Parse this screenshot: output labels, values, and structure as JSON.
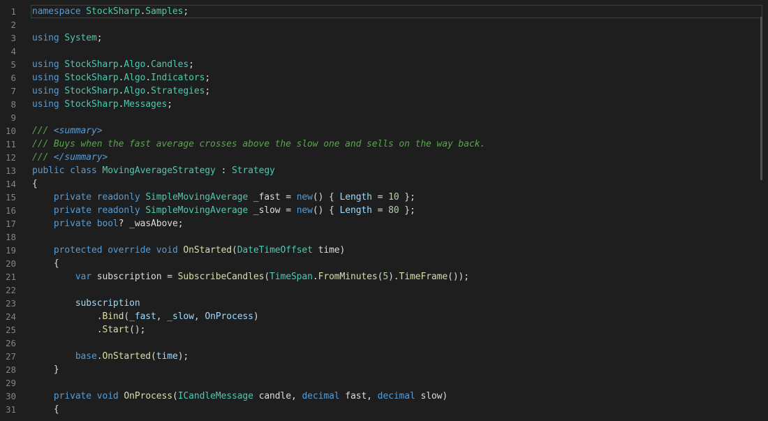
{
  "editor": {
    "line_numbers": [
      "1",
      "2",
      "3",
      "4",
      "5",
      "6",
      "7",
      "8",
      "9",
      "10",
      "11",
      "12",
      "13",
      "14",
      "15",
      "16",
      "17",
      "18",
      "19",
      "20",
      "21",
      "22",
      "23",
      "24",
      "25",
      "26",
      "27",
      "28",
      "29",
      "30",
      "31"
    ],
    "lines": [
      [
        [
          "kw",
          "namespace"
        ],
        [
          "id",
          " "
        ],
        [
          "ns",
          "StockSharp"
        ],
        [
          "punc",
          "."
        ],
        [
          "ns",
          "Samples"
        ],
        [
          "punc",
          ";"
        ]
      ],
      [],
      [
        [
          "kw",
          "using"
        ],
        [
          "id",
          " "
        ],
        [
          "ns",
          "System"
        ],
        [
          "punc",
          ";"
        ]
      ],
      [],
      [
        [
          "kw",
          "using"
        ],
        [
          "id",
          " "
        ],
        [
          "ns",
          "StockSharp"
        ],
        [
          "punc",
          "."
        ],
        [
          "ns",
          "Algo"
        ],
        [
          "punc",
          "."
        ],
        [
          "ns",
          "Candles"
        ],
        [
          "punc",
          ";"
        ]
      ],
      [
        [
          "kw",
          "using"
        ],
        [
          "id",
          " "
        ],
        [
          "ns",
          "StockSharp"
        ],
        [
          "punc",
          "."
        ],
        [
          "ns",
          "Algo"
        ],
        [
          "punc",
          "."
        ],
        [
          "ns",
          "Indicators"
        ],
        [
          "punc",
          ";"
        ]
      ],
      [
        [
          "kw",
          "using"
        ],
        [
          "id",
          " "
        ],
        [
          "ns",
          "StockSharp"
        ],
        [
          "punc",
          "."
        ],
        [
          "ns",
          "Algo"
        ],
        [
          "punc",
          "."
        ],
        [
          "ns",
          "Strategies"
        ],
        [
          "punc",
          ";"
        ]
      ],
      [
        [
          "kw",
          "using"
        ],
        [
          "id",
          " "
        ],
        [
          "ns",
          "StockSharp"
        ],
        [
          "punc",
          "."
        ],
        [
          "ns",
          "Messages"
        ],
        [
          "punc",
          ";"
        ]
      ],
      [],
      [
        [
          "comment",
          "/// "
        ],
        [
          "xml",
          "<summary>"
        ]
      ],
      [
        [
          "comment",
          "/// Buys when the fast average crosses above the slow one and sells on the way back."
        ]
      ],
      [
        [
          "comment",
          "/// "
        ],
        [
          "xml",
          "</summary>"
        ]
      ],
      [
        [
          "kw",
          "public"
        ],
        [
          "id",
          " "
        ],
        [
          "kw",
          "class"
        ],
        [
          "id",
          " "
        ],
        [
          "type",
          "MovingAverageStrategy"
        ],
        [
          "id",
          " "
        ],
        [
          "punc",
          ":"
        ],
        [
          "id",
          " "
        ],
        [
          "type",
          "Strategy"
        ]
      ],
      [
        [
          "punc",
          "{"
        ]
      ],
      [
        [
          "id",
          "    "
        ],
        [
          "kw",
          "private"
        ],
        [
          "id",
          " "
        ],
        [
          "kw",
          "readonly"
        ],
        [
          "id",
          " "
        ],
        [
          "type",
          "SimpleMovingAverage"
        ],
        [
          "id",
          " _fast "
        ],
        [
          "punc",
          "="
        ],
        [
          "id",
          " "
        ],
        [
          "kw",
          "new"
        ],
        [
          "punc",
          "() { "
        ],
        [
          "prop",
          "Length"
        ],
        [
          "id",
          " "
        ],
        [
          "punc",
          "="
        ],
        [
          "id",
          " "
        ],
        [
          "num",
          "10"
        ],
        [
          "punc",
          " };"
        ]
      ],
      [
        [
          "id",
          "    "
        ],
        [
          "kw",
          "private"
        ],
        [
          "id",
          " "
        ],
        [
          "kw",
          "readonly"
        ],
        [
          "id",
          " "
        ],
        [
          "type",
          "SimpleMovingAverage"
        ],
        [
          "id",
          " _slow "
        ],
        [
          "punc",
          "="
        ],
        [
          "id",
          " "
        ],
        [
          "kw",
          "new"
        ],
        [
          "punc",
          "() { "
        ],
        [
          "prop",
          "Length"
        ],
        [
          "id",
          " "
        ],
        [
          "punc",
          "="
        ],
        [
          "id",
          " "
        ],
        [
          "num",
          "80"
        ],
        [
          "punc",
          " };"
        ]
      ],
      [
        [
          "id",
          "    "
        ],
        [
          "kw",
          "private"
        ],
        [
          "id",
          " "
        ],
        [
          "kw",
          "bool"
        ],
        [
          "punc",
          "?"
        ],
        [
          "id",
          " _wasAbove"
        ],
        [
          "punc",
          ";"
        ]
      ],
      [],
      [
        [
          "id",
          "    "
        ],
        [
          "kw",
          "protected"
        ],
        [
          "id",
          " "
        ],
        [
          "kw",
          "override"
        ],
        [
          "id",
          " "
        ],
        [
          "kw",
          "void"
        ],
        [
          "id",
          " "
        ],
        [
          "method",
          "OnStarted"
        ],
        [
          "punc",
          "("
        ],
        [
          "type",
          "DateTimeOffset"
        ],
        [
          "id",
          " time"
        ],
        [
          "punc",
          ")"
        ]
      ],
      [
        [
          "id",
          "    "
        ],
        [
          "punc",
          "{"
        ]
      ],
      [
        [
          "id",
          "        "
        ],
        [
          "kw",
          "var"
        ],
        [
          "id",
          " subscription "
        ],
        [
          "punc",
          "="
        ],
        [
          "id",
          " "
        ],
        [
          "method",
          "SubscribeCandles"
        ],
        [
          "punc",
          "("
        ],
        [
          "type",
          "TimeSpan"
        ],
        [
          "punc",
          "."
        ],
        [
          "method",
          "FromMinutes"
        ],
        [
          "punc",
          "("
        ],
        [
          "num",
          "5"
        ],
        [
          "punc",
          ")."
        ],
        [
          "method",
          "TimeFrame"
        ],
        [
          "punc",
          "());"
        ]
      ],
      [],
      [
        [
          "id",
          "        "
        ],
        [
          "prop",
          "subscription"
        ]
      ],
      [
        [
          "id",
          "            "
        ],
        [
          "punc",
          "."
        ],
        [
          "method",
          "Bind"
        ],
        [
          "punc",
          "("
        ],
        [
          "prop",
          "_fast"
        ],
        [
          "punc",
          ", "
        ],
        [
          "prop",
          "_slow"
        ],
        [
          "punc",
          ", "
        ],
        [
          "prop",
          "OnProcess"
        ],
        [
          "punc",
          ")"
        ]
      ],
      [
        [
          "id",
          "            "
        ],
        [
          "punc",
          "."
        ],
        [
          "method",
          "Start"
        ],
        [
          "punc",
          "();"
        ]
      ],
      [],
      [
        [
          "id",
          "        "
        ],
        [
          "kw",
          "base"
        ],
        [
          "punc",
          "."
        ],
        [
          "method",
          "OnStarted"
        ],
        [
          "punc",
          "("
        ],
        [
          "prop",
          "time"
        ],
        [
          "punc",
          ");"
        ]
      ],
      [
        [
          "id",
          "    "
        ],
        [
          "punc",
          "}"
        ]
      ],
      [],
      [
        [
          "id",
          "    "
        ],
        [
          "kw",
          "private"
        ],
        [
          "id",
          " "
        ],
        [
          "kw",
          "void"
        ],
        [
          "id",
          " "
        ],
        [
          "method",
          "OnProcess"
        ],
        [
          "punc",
          "("
        ],
        [
          "type",
          "ICandleMessage"
        ],
        [
          "id",
          " candle"
        ],
        [
          "punc",
          ", "
        ],
        [
          "kw",
          "decimal"
        ],
        [
          "id",
          " fast"
        ],
        [
          "punc",
          ", "
        ],
        [
          "kw",
          "decimal"
        ],
        [
          "id",
          " slow"
        ],
        [
          "punc",
          ")"
        ]
      ],
      [
        [
          "id",
          "    "
        ],
        [
          "punc",
          "{"
        ]
      ]
    ]
  }
}
